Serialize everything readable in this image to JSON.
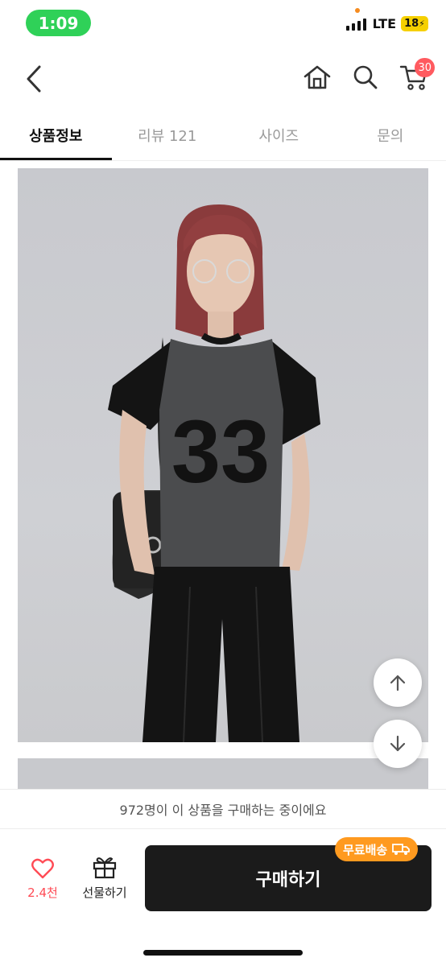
{
  "status_bar": {
    "time": "1:09",
    "network": "LTE",
    "battery": "18"
  },
  "top_nav": {
    "back_icon": "chevron-left-icon",
    "home_icon": "home-icon",
    "search_icon": "search-icon",
    "cart_icon": "cart-icon",
    "cart_count": "30"
  },
  "tabs": [
    {
      "label": "상품정보",
      "active": true
    },
    {
      "label": "리뷰 121",
      "active": false
    },
    {
      "label": "사이즈",
      "active": false
    },
    {
      "label": "문의",
      "active": false
    }
  ],
  "product": {
    "shirt_text": "33"
  },
  "scroll": {
    "up_icon": "arrow-up-icon",
    "down_icon": "arrow-down-icon"
  },
  "notice": "972명이 이 상품을 구매하는 중이에요",
  "bottom": {
    "like_count": "2.4천",
    "gift_label": "선물하기",
    "buy_label": "구매하기",
    "free_shipping": "무료배송"
  },
  "colors": {
    "accent_red": "#ff4b55",
    "badge_orange": "#ff9a1f",
    "buy_button": "#1b1b1b",
    "status_green": "#2fd158"
  }
}
